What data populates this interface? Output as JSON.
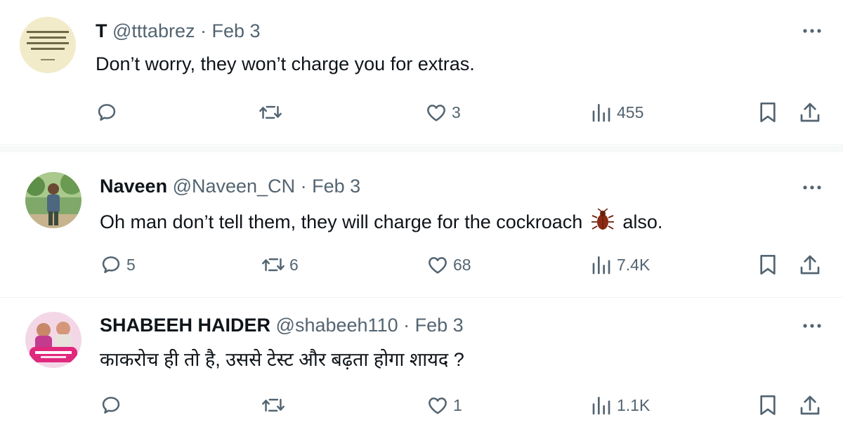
{
  "tweets": [
    {
      "display_name": "T",
      "handle": "@tttabrez",
      "separator": "·",
      "date": "Feb 3",
      "text": "Don’t worry, they won’t charge you for extras.",
      "replies": "",
      "retweets": "",
      "likes": "3",
      "views": "455",
      "avatar_icon": "quote-card-avatar"
    },
    {
      "display_name": "Naveen",
      "handle": "@Naveen_CN",
      "separator": "·",
      "date": "Feb 3",
      "text_before": "Oh man don’t tell them, they will charge for the cockroach",
      "text_after": "also.",
      "emoji_icon": "cockroach-emoji",
      "replies": "5",
      "retweets": "6",
      "likes": "68",
      "views": "7.4K",
      "avatar_icon": "person-photo-avatar"
    },
    {
      "display_name": "SHABEEH HAIDER",
      "handle": "@shabeeh110",
      "separator": "·",
      "date": "Feb 3",
      "text": "काकरोच ही तो है, उससे टेस्ट और बढ़ता होगा शायद ?",
      "replies": "",
      "retweets": "",
      "likes": "1",
      "views": "1.1K",
      "avatar_icon": "pink-badge-avatar"
    }
  ],
  "icons": {
    "reply": "reply-icon",
    "retweet": "retweet-icon",
    "like": "heart-icon",
    "views": "views-chart-icon",
    "bookmark": "bookmark-icon",
    "share": "share-icon",
    "more": "more-dots-icon"
  },
  "colors": {
    "text_primary": "#0f1419",
    "text_secondary": "#536471",
    "divider": "#eff3f4"
  }
}
